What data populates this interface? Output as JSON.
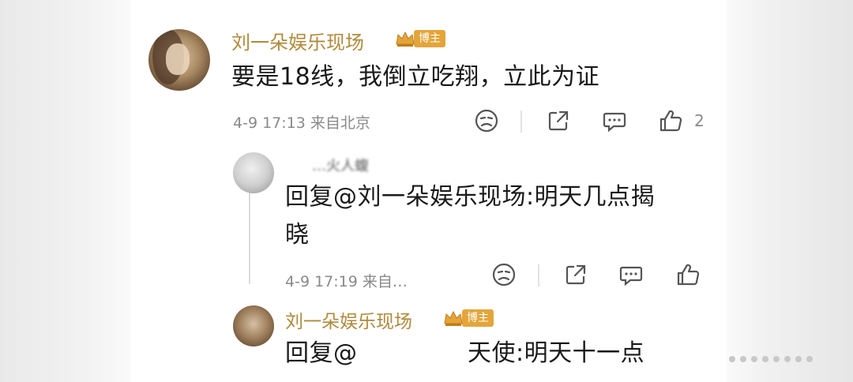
{
  "comment": {
    "author": "刘一朵娱乐现场",
    "badge": "博主",
    "text": "要是18线，我倒立吃翔，立此为证",
    "meta": "4-9 17:13 来自北京",
    "like_count": "2"
  },
  "replies": [
    {
      "author": "…火人蝮",
      "text_line1": "回复@刘一朵娱乐现场:明天几点揭",
      "text_line2": "晓",
      "meta": "4-9 17:19 来自…"
    },
    {
      "author": "刘一朵娱乐现场",
      "badge": "博主",
      "text_prefix": "回复@l",
      "text_suffix": "天使:明天十一点"
    }
  ],
  "icons": [
    "dislike-icon",
    "share-icon",
    "comment-icon",
    "like-icon",
    "crown-icon"
  ]
}
